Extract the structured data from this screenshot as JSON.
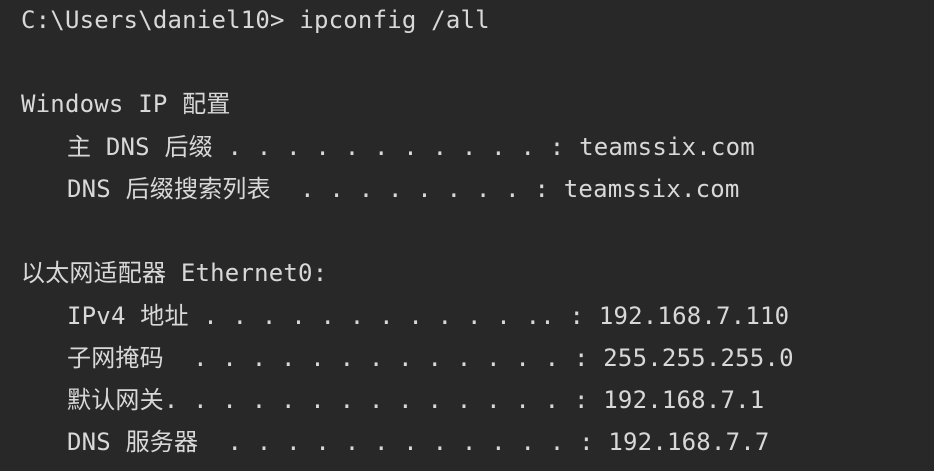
{
  "terminal": {
    "prompt_line": "C:\\Users\\daniel10> ipconfig /all",
    "sections": {
      "windows_ip": {
        "heading": "Windows IP 配置",
        "rows": [
          "主 DNS 后缀 . . . . . . . . . . . : teamssix.com",
          "DNS 后缀搜索列表  . . . . . . . . : teamssix.com"
        ]
      },
      "ethernet": {
        "heading": "以太网适配器 Ethernet0:",
        "rows": [
          "IPv4 地址 . . . . . . . . . . . .. : 192.168.7.110",
          "子网掩码  . . . . . . . . . . . . . : 255.255.255.0",
          "默认网关. . . . . . . . . . . . . . : 192.168.7.1",
          "DNS 服务器  . . . . . . . . . . . . : 192.168.7.7"
        ]
      }
    }
  }
}
